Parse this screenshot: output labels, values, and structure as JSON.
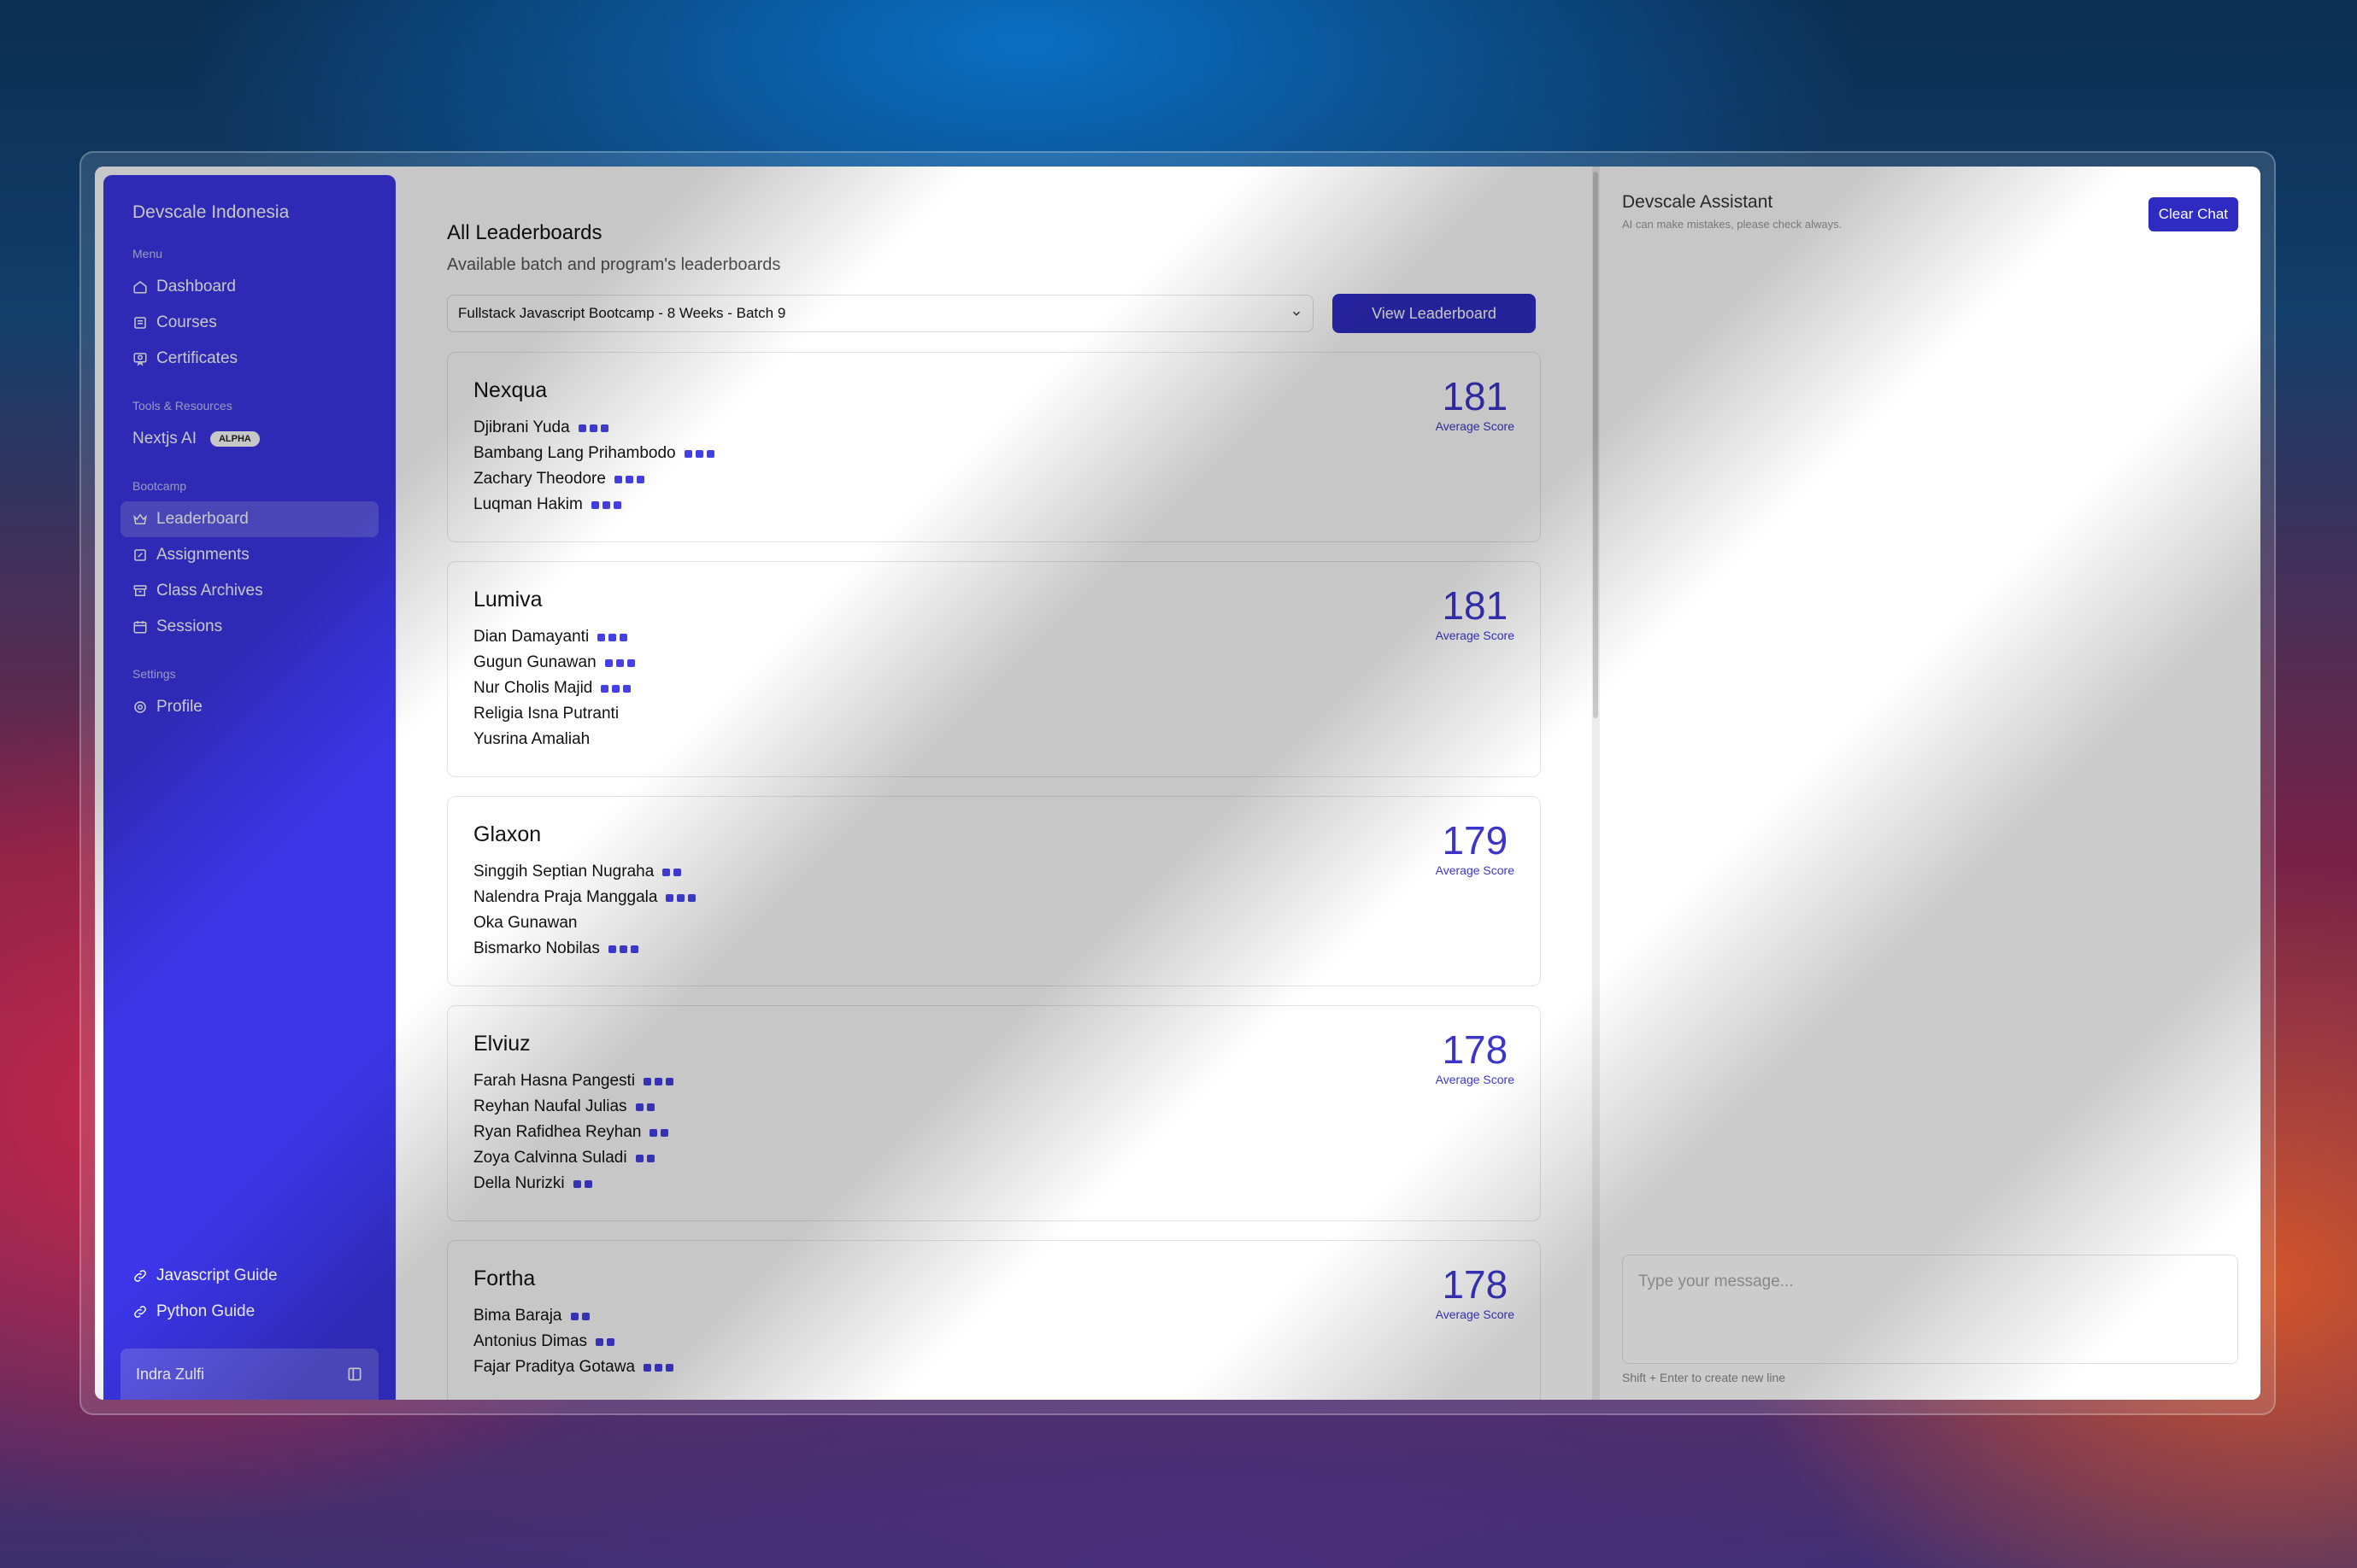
{
  "sidebar": {
    "brand": "Devscale Indonesia",
    "sections": {
      "menu": "Menu",
      "tools": "Tools & Resources",
      "bootcamp": "Bootcamp",
      "settings": "Settings"
    },
    "menu_items": [
      "Dashboard",
      "Courses",
      "Certificates"
    ],
    "tools_item": "Nextjs AI",
    "tools_badge": "ALPHA",
    "bootcamp_items": [
      "Leaderboard",
      "Assignments",
      "Class Archives",
      "Sessions"
    ],
    "settings_items": [
      "Profile"
    ],
    "guides": [
      "Javascript Guide",
      "Python Guide"
    ],
    "user": "Indra Zulfi"
  },
  "main": {
    "title": "All Leaderboards",
    "subtitle": "Available batch and program's leaderboards",
    "select_value": "Fullstack Javascript Bootcamp - 8 Weeks - Batch 9",
    "view_button": "View Leaderboard",
    "score_label": "Average Score",
    "teams": [
      {
        "name": "Nexqua",
        "score": "181",
        "members": [
          {
            "name": "Djibrani Yuda",
            "dots": 3
          },
          {
            "name": "Bambang Lang Prihambodo",
            "dots": 3
          },
          {
            "name": "Zachary Theodore",
            "dots": 3
          },
          {
            "name": "Luqman Hakim",
            "dots": 3
          }
        ]
      },
      {
        "name": "Lumiva",
        "score": "181",
        "members": [
          {
            "name": "Dian Damayanti",
            "dots": 3
          },
          {
            "name": "Gugun Gunawan",
            "dots": 3
          },
          {
            "name": "Nur Cholis Majid",
            "dots": 3
          },
          {
            "name": "Religia Isna Putranti",
            "dots": 0
          },
          {
            "name": "Yusrina Amaliah",
            "dots": 0
          }
        ]
      },
      {
        "name": "Glaxon",
        "score": "179",
        "members": [
          {
            "name": "Singgih Septian Nugraha",
            "dots": 2
          },
          {
            "name": "Nalendra Praja Manggala",
            "dots": 3
          },
          {
            "name": "Oka Gunawan",
            "dots": 0
          },
          {
            "name": "Bismarko Nobilas",
            "dots": 3
          }
        ]
      },
      {
        "name": "Elviuz",
        "score": "178",
        "members": [
          {
            "name": "Farah Hasna Pangesti",
            "dots": 3
          },
          {
            "name": "Reyhan Naufal Julias",
            "dots": 2
          },
          {
            "name": "Ryan Rafidhea Reyhan",
            "dots": 2
          },
          {
            "name": "Zoya Calvinna Suladi",
            "dots": 2
          },
          {
            "name": "Della Nurizki",
            "dots": 2
          }
        ]
      },
      {
        "name": "Fortha",
        "score": "178",
        "members": [
          {
            "name": "Bima Baraja",
            "dots": 2
          },
          {
            "name": "Antonius Dimas",
            "dots": 2
          },
          {
            "name": "Fajar Praditya Gotawa",
            "dots": 3
          }
        ]
      }
    ]
  },
  "assistant": {
    "title": "Devscale Assistant",
    "subtitle": "AI can make mistakes, please check always.",
    "clear_button": "Clear Chat",
    "placeholder": "Type your message...",
    "hint": "Shift + Enter to create new line"
  },
  "colors": {
    "accent": "#3b36e8",
    "button": "#2e2bc2",
    "score": "#3b36c9"
  }
}
